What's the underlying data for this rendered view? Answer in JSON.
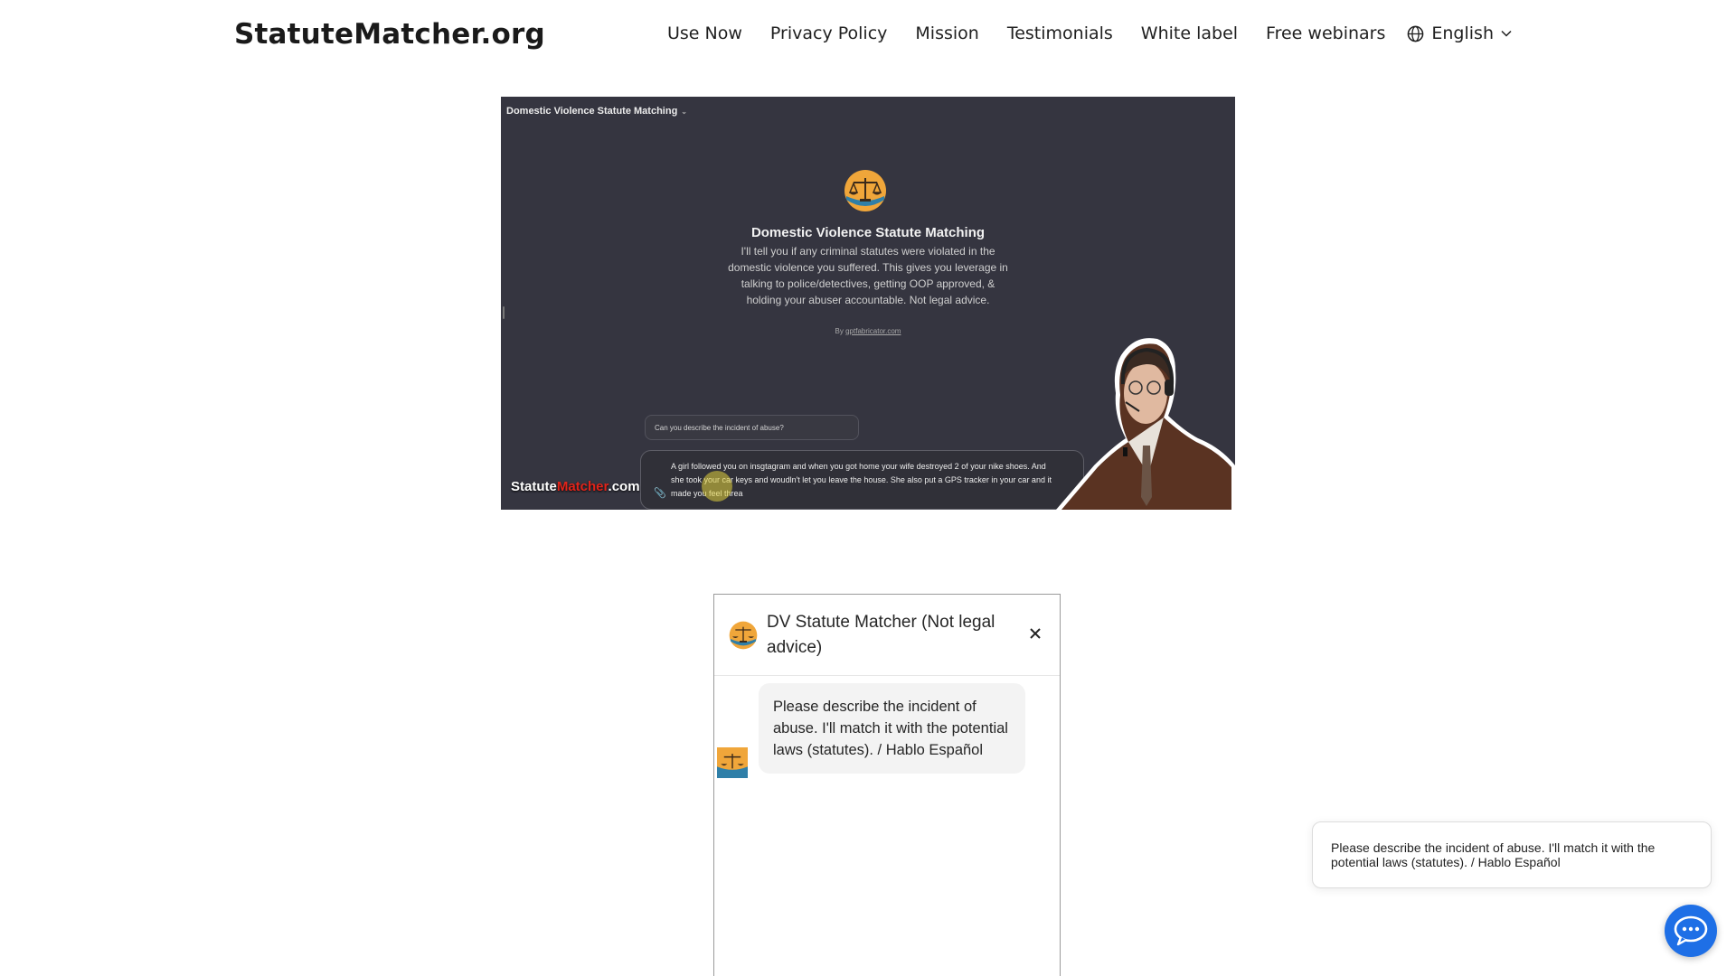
{
  "header": {
    "logo": "StatuteMatcher.org",
    "nav": [
      "Use Now",
      "Privacy Policy",
      "Mission",
      "Testimonials",
      "White label",
      "Free webinars"
    ],
    "language": "English"
  },
  "video": {
    "topbar_title": "Domestic Violence Statute Matching",
    "title": "Domestic Violence Statute Matching",
    "description": "I'll tell you if any criminal statutes were violated in the domestic violence you suffered. This gives you leverage in talking to police/detectives, getting OOP approved, & holding your abuser accountable. Not legal advice.",
    "by_prefix": "By",
    "by_link": "gptfabricator.com",
    "question": "Can you describe the incident of abuse?",
    "input_text": "A girl followed you on insgtagram and when you got home your wife destroyed 2 of your nike shoes. And she took your car keys and woudln't let you leave the house. She also put a GPS tracker in your car and it made you feel threa",
    "watermark_a": "Statute",
    "watermark_b": "Matcher",
    "watermark_c": ".com"
  },
  "chat": {
    "title": "DV Statute Matcher (Not legal advice)",
    "message": "Please describe the incident of abuse. I'll match it with the potential laws (statutes). / Hablo Español"
  },
  "toast": {
    "message": "Please describe the incident of abuse. I'll match it with the potential laws (statutes). / Hablo Español"
  },
  "icons": {
    "language": "globe-icon",
    "dropdown": "chevron-down-icon",
    "logo": "scales-of-justice-icon",
    "close": "close-icon",
    "attach": "paperclip-icon",
    "launcher": "chat-bubble-icon"
  },
  "colors": {
    "video_bg": "#353540",
    "launcher": "#1e6fe6",
    "watermark_accent": "#e1241a"
  }
}
